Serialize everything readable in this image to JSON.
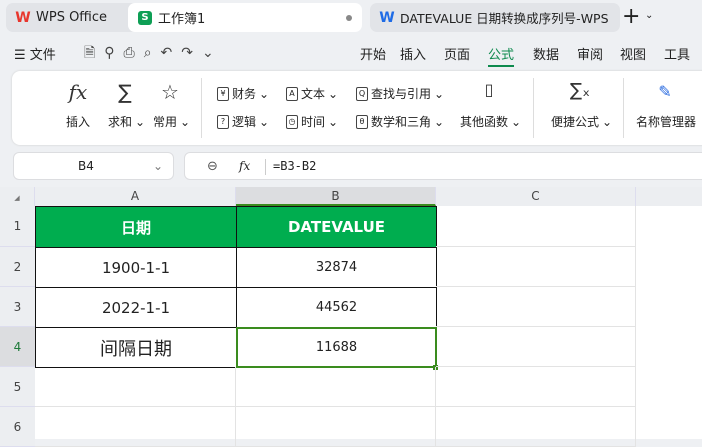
{
  "tabs": [
    {
      "label": "WPS Office",
      "icon": "wps-logo-icon"
    },
    {
      "label": "工作簿1",
      "icon": "spreadsheet-icon"
    },
    {
      "label": "DATEVALUE 日期转换成序列号-WPS",
      "icon": "wps-writer-icon"
    }
  ],
  "toolbar": {
    "file": "文件",
    "menus": [
      "开始",
      "插入",
      "页面",
      "公式",
      "数据",
      "审阅",
      "视图",
      "工具"
    ],
    "active_menu": "公式"
  },
  "ribbon": {
    "insert": "插入",
    "sum": "求和",
    "common": "常用",
    "finance": "财务",
    "logic": "逻辑",
    "text": "文本",
    "time": "时间",
    "lookup": "查找与引用",
    "math": "数学和三角",
    "other": "其他函数",
    "quick": "便捷公式",
    "name_mgr": "名称管理器"
  },
  "formula_bar": {
    "cell_ref": "B4",
    "fx": "fx",
    "formula": "=B3-B2"
  },
  "columns": [
    "A",
    "B",
    "C"
  ],
  "rows": [
    "1",
    "2",
    "3",
    "4",
    "5",
    "6"
  ],
  "cells": {
    "A1": "日期",
    "B1": "DATEVALUE",
    "A2": "1900-1-1",
    "B2": "32874",
    "A3": "2022-1-1",
    "B3": "44562",
    "A4": "间隔日期",
    "B4": "11688"
  },
  "colors": {
    "accent": "#00ad4f",
    "selection": "#3a8c1e"
  }
}
